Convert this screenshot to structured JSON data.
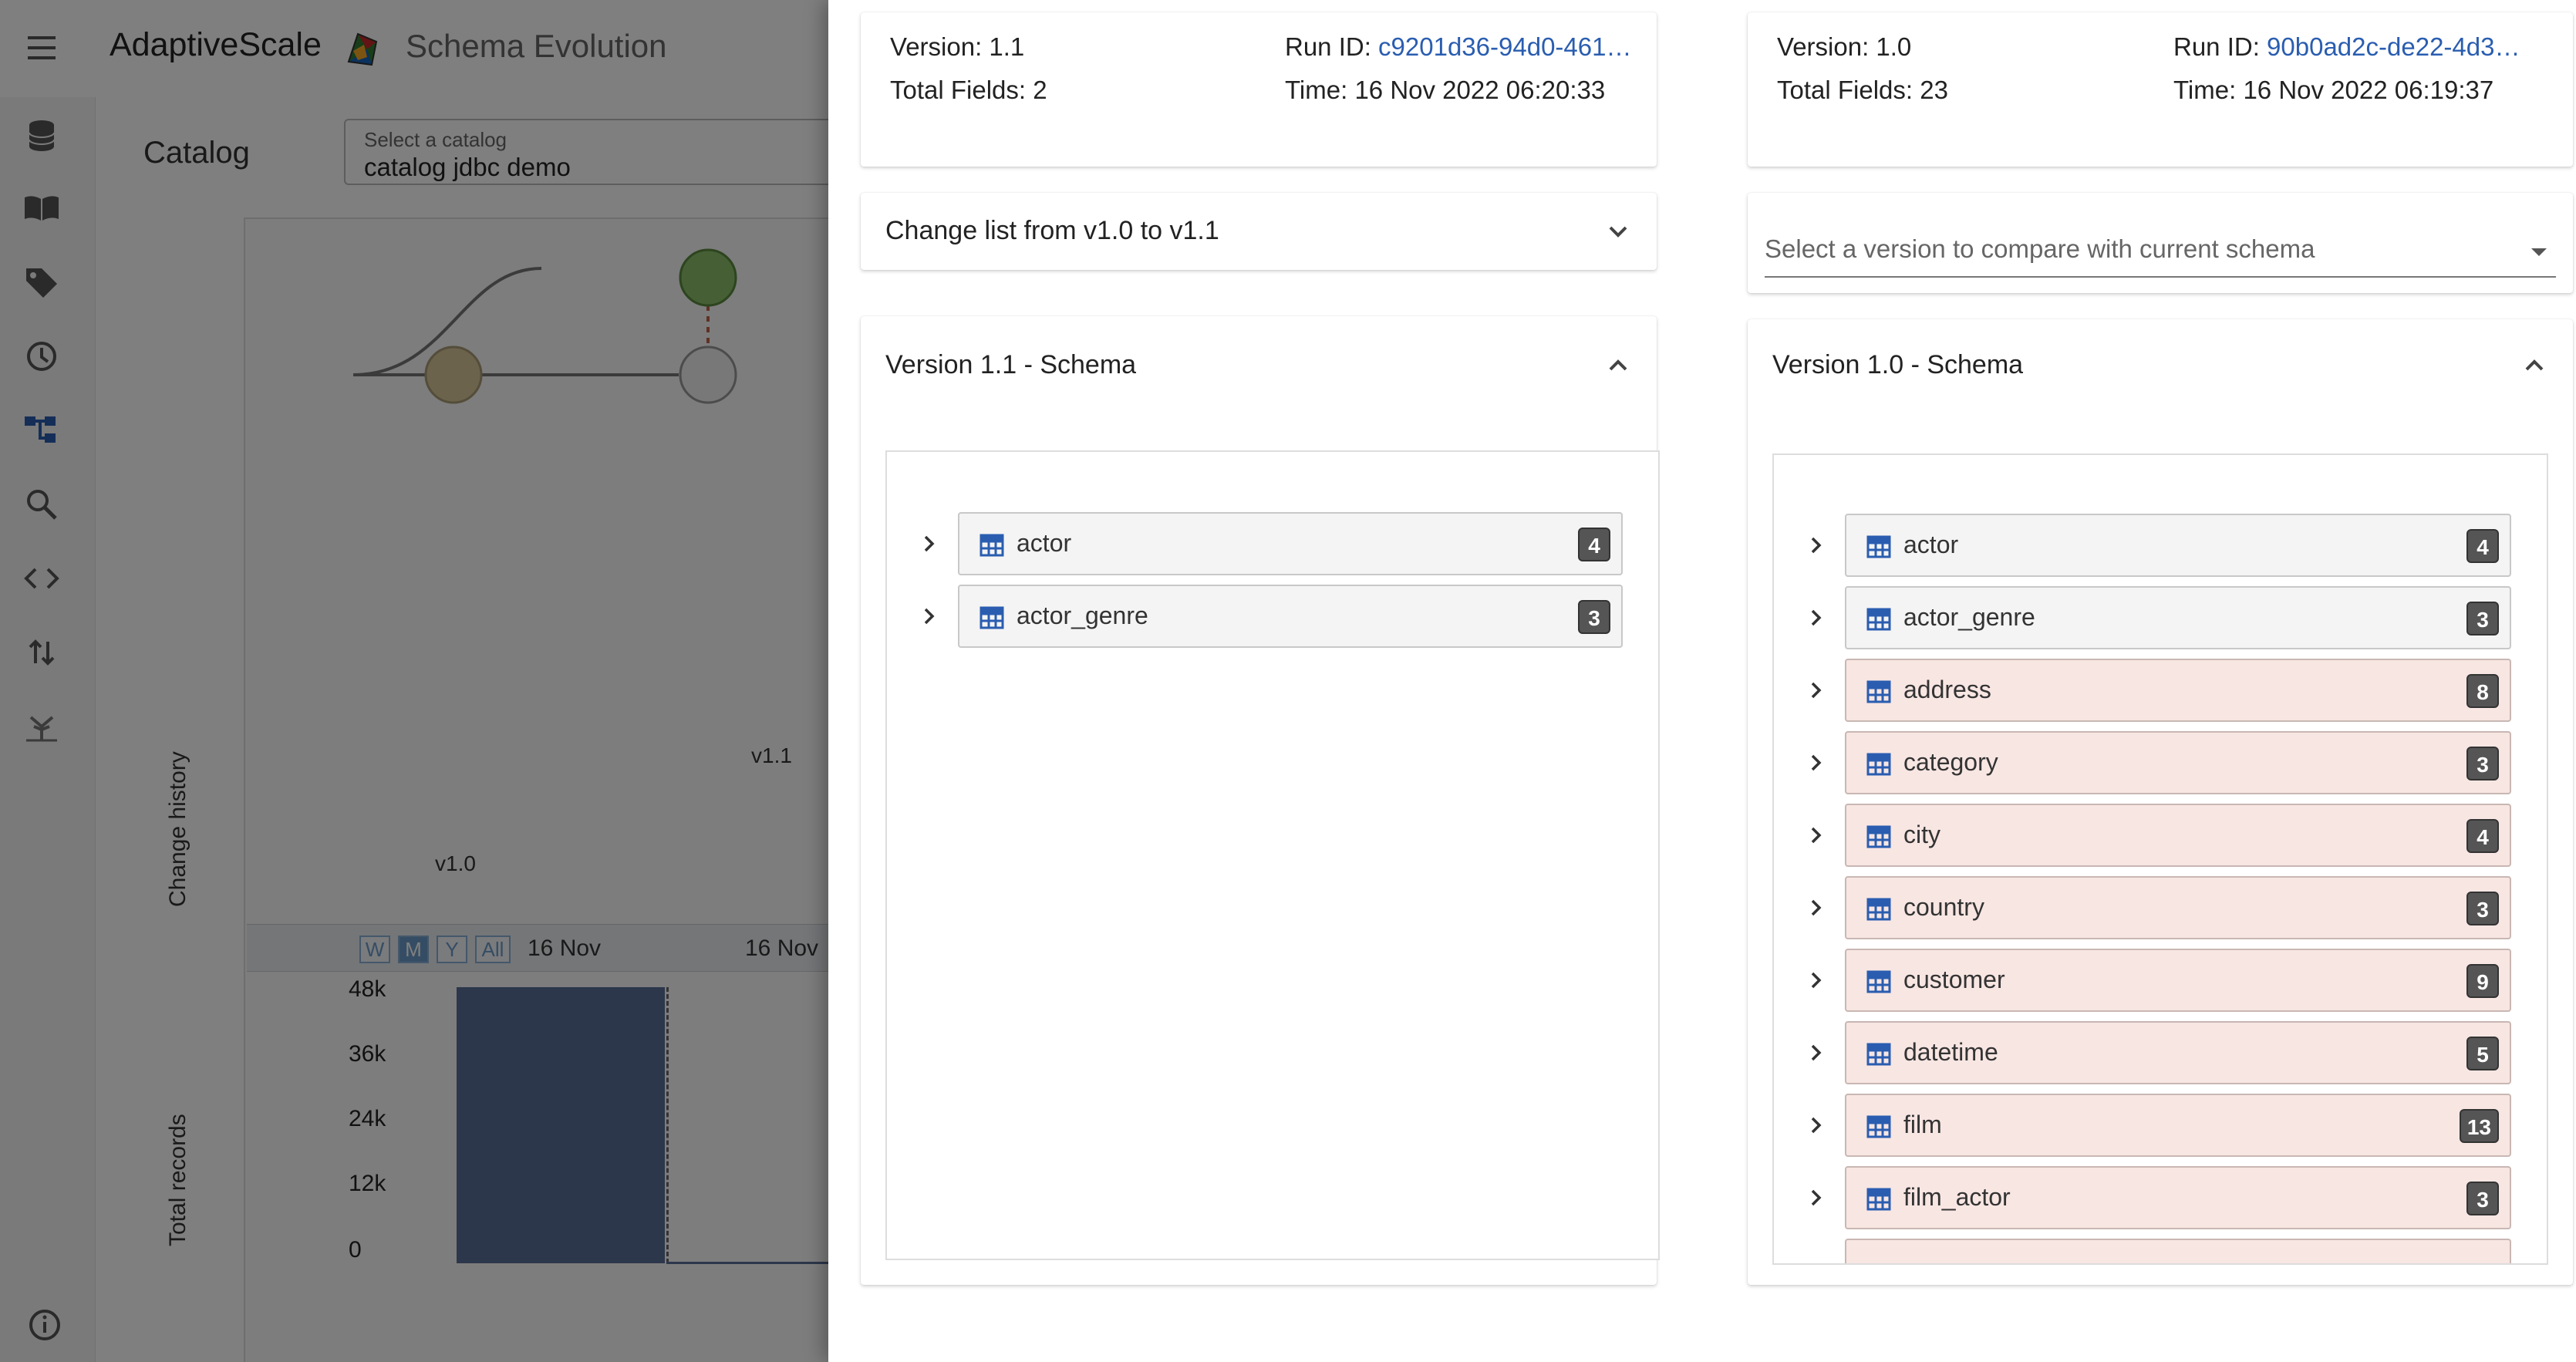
{
  "app": {
    "brand": "AdaptiveScale",
    "title": "Schema Evolution"
  },
  "sidebar": {
    "icons": [
      "database-icon",
      "book-icon",
      "tag-icon",
      "clock-icon",
      "schema-tree-icon",
      "search-icon",
      "code-icon",
      "transfer-icon",
      "lineage-icon",
      "info-icon"
    ]
  },
  "catalog": {
    "label": "Catalog",
    "select_label": "Select a catalog",
    "select_value": "catalog jdbc demo"
  },
  "graph": {
    "y_axis_label": "Change history",
    "nodes": [
      {
        "label": "v1.0",
        "color": "#d9c79a"
      },
      {
        "label": "v1.1",
        "color": "#8cbf6b"
      }
    ],
    "range_buttons": [
      "W",
      "M",
      "Y",
      "All"
    ],
    "active_range": "M",
    "timeline_dates": [
      "16 Nov",
      "16 Nov"
    ]
  },
  "records_chart": {
    "ylabel": "Total records",
    "y_ticks": [
      "48k",
      "36k",
      "24k",
      "12k",
      "0"
    ],
    "bar_color": "#5a6f96"
  },
  "left_panel": {
    "version_label": "Version: 1.1",
    "total_fields_label": "Total Fields: 2",
    "run_id_prefix": "Run ID: ",
    "run_id": "c9201d36-94d0-461…",
    "time_label": "Time: 16 Nov 2022 06:20:33",
    "change_list_title": "Change list from v1.0 to v1.1",
    "schema_title": "Version 1.1 - Schema",
    "tables": [
      {
        "name": "actor",
        "count": "4"
      },
      {
        "name": "actor_genre",
        "count": "3"
      }
    ]
  },
  "right_panel": {
    "version_label": "Version: 1.0",
    "total_fields_label": "Total Fields: 23",
    "run_id_prefix": "Run ID: ",
    "run_id": "90b0ad2c-de22-4d3…",
    "time_label": "Time: 16 Nov 2022 06:19:37",
    "compare_placeholder": "Select a version to compare with current schema",
    "schema_title": "Version 1.0 - Schema",
    "tables": [
      {
        "name": "actor",
        "count": "4",
        "removed": false
      },
      {
        "name": "actor_genre",
        "count": "3",
        "removed": false
      },
      {
        "name": "address",
        "count": "8",
        "removed": true
      },
      {
        "name": "category",
        "count": "3",
        "removed": true
      },
      {
        "name": "city",
        "count": "4",
        "removed": true
      },
      {
        "name": "country",
        "count": "3",
        "removed": true
      },
      {
        "name": "customer",
        "count": "9",
        "removed": true
      },
      {
        "name": "datetime",
        "count": "5",
        "removed": true
      },
      {
        "name": "film",
        "count": "13",
        "removed": true
      },
      {
        "name": "film_actor",
        "count": "3",
        "removed": true
      }
    ]
  },
  "colors": {
    "accent": "#2a5db0",
    "removed_row": "#f8e6e3",
    "count_badge": "#555555"
  }
}
